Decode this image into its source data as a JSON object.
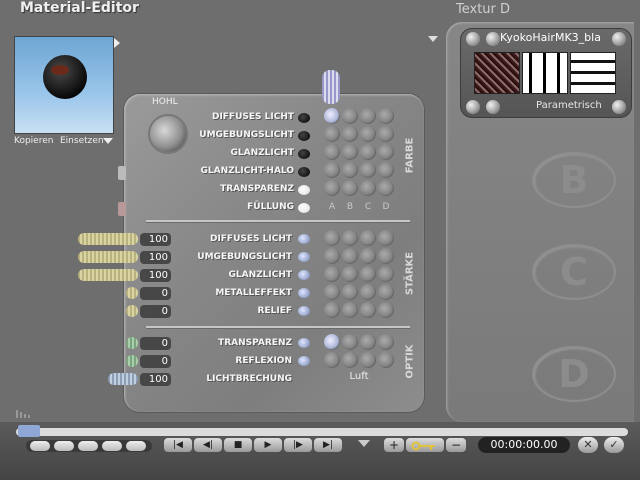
{
  "header": {
    "title": "Material-Editor",
    "texture_title": "Textur D"
  },
  "preview": {
    "copy_label": "Kopieren",
    "paste_label": "Einsetzen"
  },
  "texture": {
    "name": "KyokoHairMK3_bla",
    "mode": "Parametrisch"
  },
  "ghost_letters": [
    "B",
    "C",
    "D"
  ],
  "hohl_label": "HOHL",
  "farbe": {
    "section_label": "FARBE",
    "rows": [
      {
        "label": "DIFFUSES LICHT",
        "swatch": "#000000"
      },
      {
        "label": "UMGEBUNGSLICHT",
        "swatch": "#000000"
      },
      {
        "label": "GLANZLICHT",
        "swatch": "#000000"
      },
      {
        "label": "GLANZLICHT-HALO",
        "swatch": "#000000"
      },
      {
        "label": "TRANSPARENZ",
        "swatch": "#ffffff"
      },
      {
        "label": "FÜLLUNG",
        "swatch": "#ffffff"
      }
    ],
    "columns": [
      "A",
      "B",
      "C",
      "D"
    ]
  },
  "staerke": {
    "section_label": "STÄRKE",
    "rows": [
      {
        "label": "DIFFUSES LICHT",
        "value": "100",
        "level": 100
      },
      {
        "label": "UMGEBUNGSLICHT",
        "value": "100",
        "level": 100
      },
      {
        "label": "GLANZLICHT",
        "value": "100",
        "level": 100
      },
      {
        "label": "METALLEFFEKT",
        "value": "0",
        "level": 0
      },
      {
        "label": "RELIEF",
        "value": "0",
        "level": 0
      }
    ]
  },
  "optik": {
    "section_label": "OPTIK",
    "rows": [
      {
        "label": "TRANSPARENZ",
        "value": "0",
        "level": 0
      },
      {
        "label": "REFLEXION",
        "value": "0",
        "level": 0
      },
      {
        "label": "LICHTBRECHUNG",
        "value": "100",
        "level": 100
      }
    ],
    "refraction_preset": "Luft"
  },
  "transport": {
    "buttons": [
      "|◀",
      "◀|",
      "■",
      "▶",
      "|▶",
      "▶|"
    ],
    "timecode": "00:00:00.00",
    "plus": "+",
    "minus": "−"
  },
  "colors": {
    "panel": "#8c8c8c",
    "background": "#6e6e6e"
  },
  "icons": [
    "preview-sphere-icon",
    "lens-icon",
    "key-icon",
    "close-icon",
    "check-icon"
  ]
}
